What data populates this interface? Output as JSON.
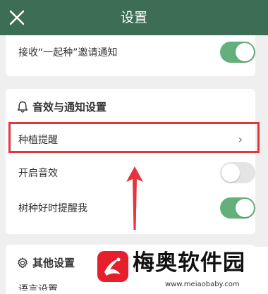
{
  "header": {
    "title": "设置",
    "close_icon": "close-icon"
  },
  "invite_row": {
    "label": "接收“一起种”邀请通知",
    "enabled": true
  },
  "sound_section": {
    "title": "音效与通知设置",
    "icon": "bell-icon",
    "items": [
      {
        "label": "种植提醒",
        "type": "link",
        "chevron": "›"
      },
      {
        "label": "开启音效",
        "type": "toggle",
        "enabled": false
      },
      {
        "label": "树种好时提醒我",
        "type": "toggle",
        "enabled": true
      }
    ]
  },
  "other_section": {
    "title": "其他设置",
    "icon": "gear-icon",
    "peek_label": "语言设置"
  },
  "watermark": {
    "title": "梅奥软件园",
    "url": "www.meiaobaby.com"
  },
  "colors": {
    "header": "#3d6e55",
    "toggle_on": "#64b07c",
    "toggle_off": "#e4e4e4",
    "highlight": "#e4343c"
  }
}
